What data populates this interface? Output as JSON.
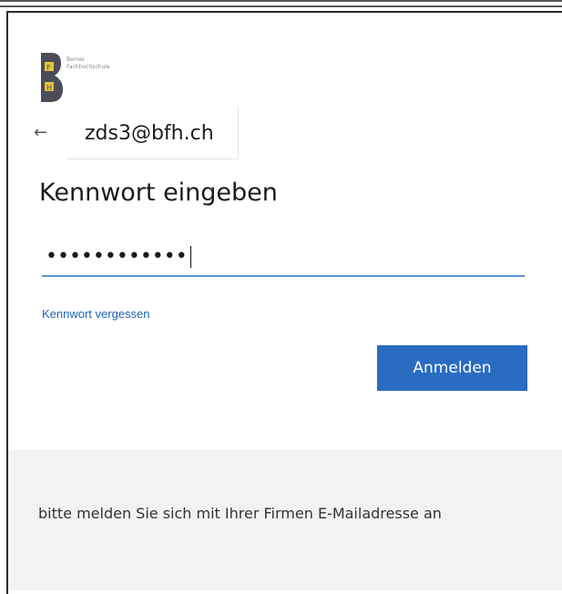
{
  "org": {
    "logo_letters": [
      "F",
      "H"
    ],
    "name_lines": "Berner\nFachhochschule"
  },
  "account": {
    "back_icon": "←",
    "email": "zds3@bfh.ch"
  },
  "form": {
    "heading": "Kennwort eingeben",
    "password_value": "••••••••••••",
    "forgot_link": "Kennwort vergessen",
    "submit_label": "Anmelden"
  },
  "footer": {
    "message": "bitte melden Sie sich mit Ihrer Firmen E-Mailadresse an"
  },
  "colors": {
    "accent": "#2a6cc1",
    "link": "#1a63b8",
    "focus_underline": "#5b95d0",
    "footer_bg": "#f2f2f2"
  }
}
